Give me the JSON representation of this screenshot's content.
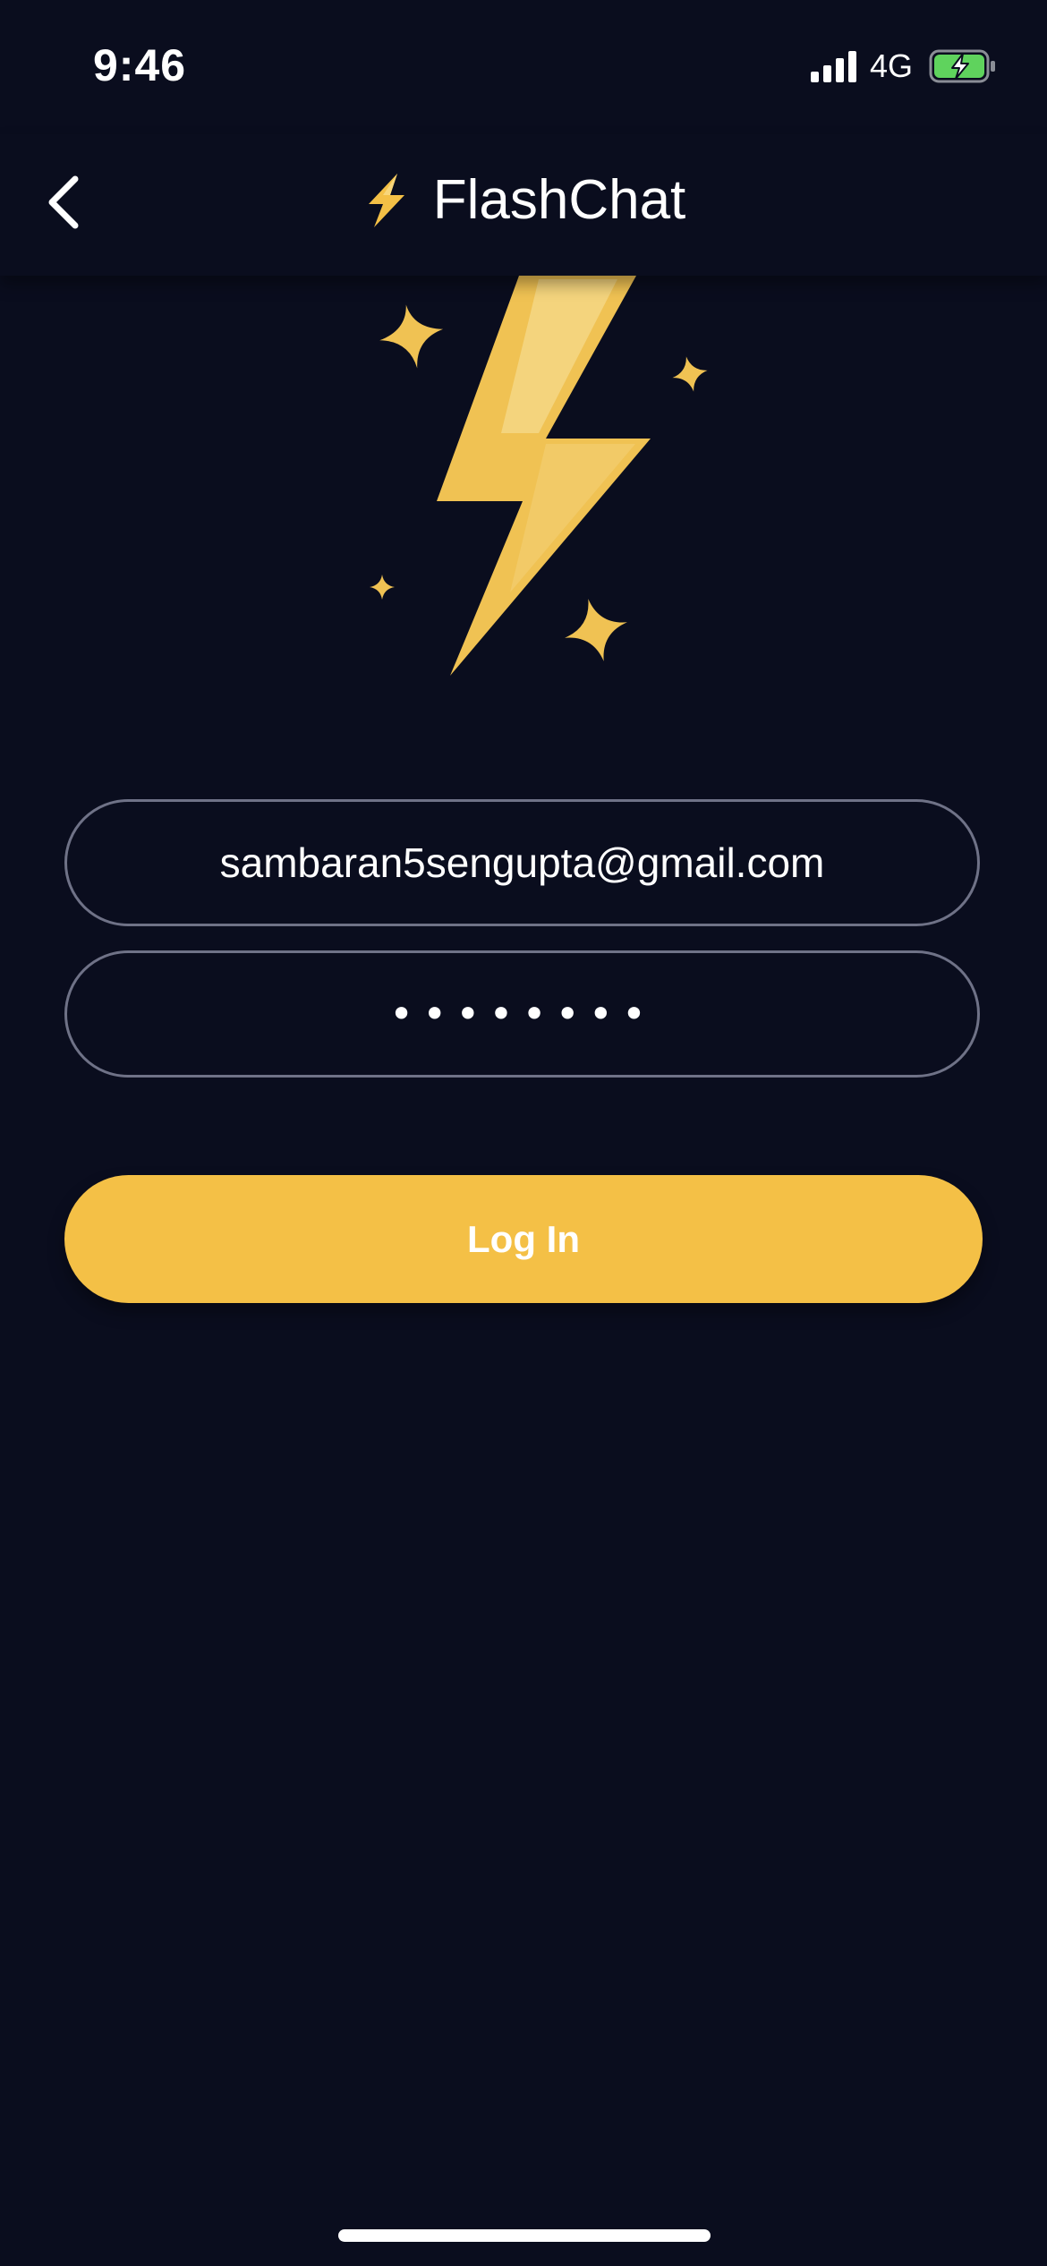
{
  "status_bar": {
    "time": "9:46",
    "network": "4G",
    "battery_color": "#5fd35d"
  },
  "nav": {
    "back_icon": "chevron-left-icon",
    "title_icon": "lightning-bolt-icon",
    "title": "FlashChat"
  },
  "hero": {
    "icon": "lightning-bolt-with-sparkles-icon",
    "accent_color": "#f4c046"
  },
  "form": {
    "email": {
      "value": "sambaran5sengupta@gmail.com"
    },
    "password": {
      "masked_value": "••••••••"
    },
    "login_label": "Log In"
  }
}
